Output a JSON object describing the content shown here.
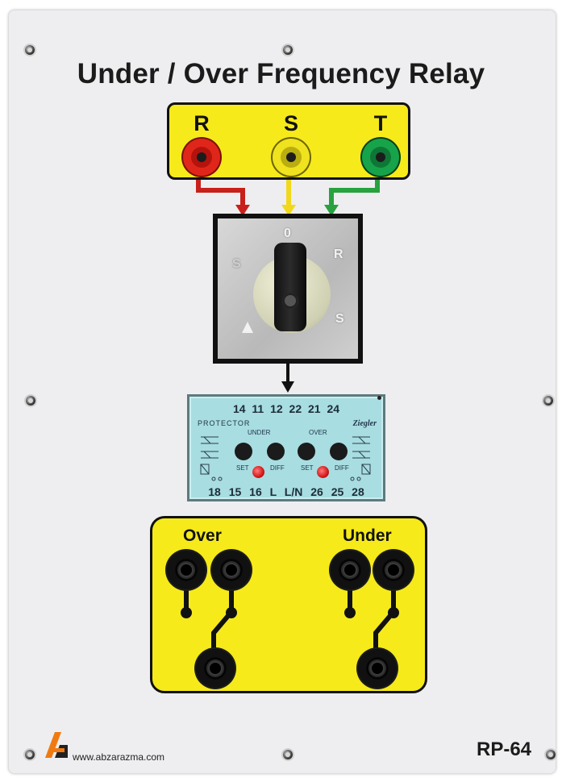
{
  "title": "Under / Over Frequency Relay",
  "phases": [
    {
      "label": "R",
      "color": "#e0261a"
    },
    {
      "label": "S",
      "color": "#f2e11c"
    },
    {
      "label": "T",
      "color": "#17a34a"
    }
  ],
  "selector_switch": {
    "positions": {
      "top": "0",
      "right_upper": "R",
      "right_lower": "S",
      "left": "S"
    }
  },
  "relay": {
    "top_terminals": "14 11 12 22 21 24",
    "bottom_terminals": "18 15 16 L L/N 26 25 28",
    "brand": "PROTECTOR",
    "maker": "Ziegler",
    "under_label": "UNDER",
    "over_label": "OVER",
    "set_label": "SET",
    "diff_label": "DIFF"
  },
  "outputs": {
    "over_label": "Over",
    "under_label": "Under"
  },
  "footer": {
    "url": "www.abzarazma.com",
    "model": "RP-64"
  },
  "colors": {
    "panel": "#eeeef0",
    "box_yellow": "#f6ea1a",
    "relay_face": "#a8dde1"
  }
}
